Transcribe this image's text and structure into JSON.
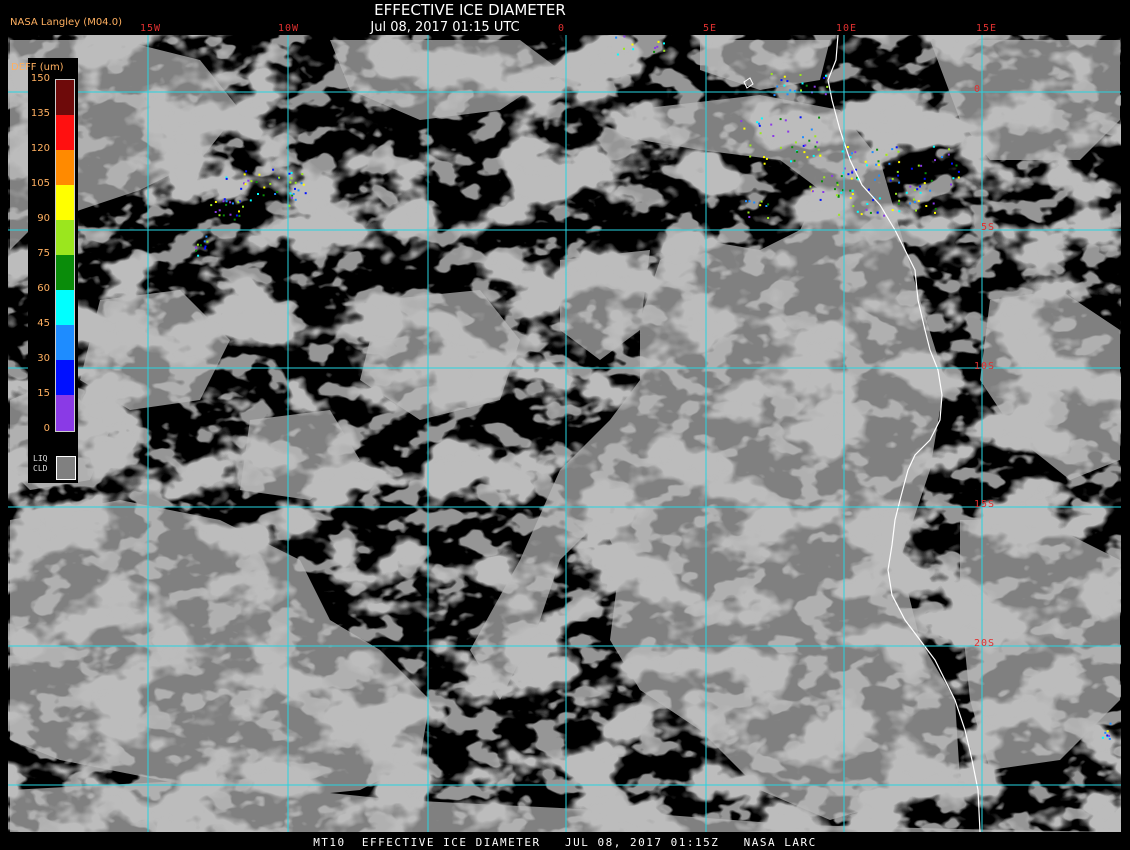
{
  "header": {
    "title": "EFFECTIVE ICE DIAMETER",
    "datetime": "Jul 08, 2017 01:15 UTC",
    "credit": "NASA Langley (M04.0)"
  },
  "footer": {
    "caption": "MT10  EFFECTIVE ICE DIAMETER   JUL 08, 2017 01:15Z   NASA LARC"
  },
  "grid": {
    "longitude_labels": [
      "15W",
      "10W",
      "0",
      "5E",
      "10E",
      "15E"
    ],
    "latitude_labels": [
      "0",
      "5S",
      "10S",
      "15S",
      "20S"
    ],
    "line_color": "#27d3e0"
  },
  "legend": {
    "title": "DEFF (um)",
    "ticks": [
      "150",
      "135",
      "120",
      "105",
      "90",
      "75",
      "60",
      "45",
      "30",
      "15",
      "0"
    ],
    "colors": [
      "#6e0a0a",
      "#ff1010",
      "#ff8a00",
      "#ffff00",
      "#9be61e",
      "#0a8c0a",
      "#00ffff",
      "#1e8cff",
      "#0010ff",
      "#8a3ae6"
    ],
    "liquid_label_line1": "LIQ",
    "liquid_label_line2": "CLD",
    "liquid_color": "#808080"
  },
  "map": {
    "cloud_color": "#808080",
    "background_color": "#000000",
    "coastline_color": "#ffffff"
  }
}
